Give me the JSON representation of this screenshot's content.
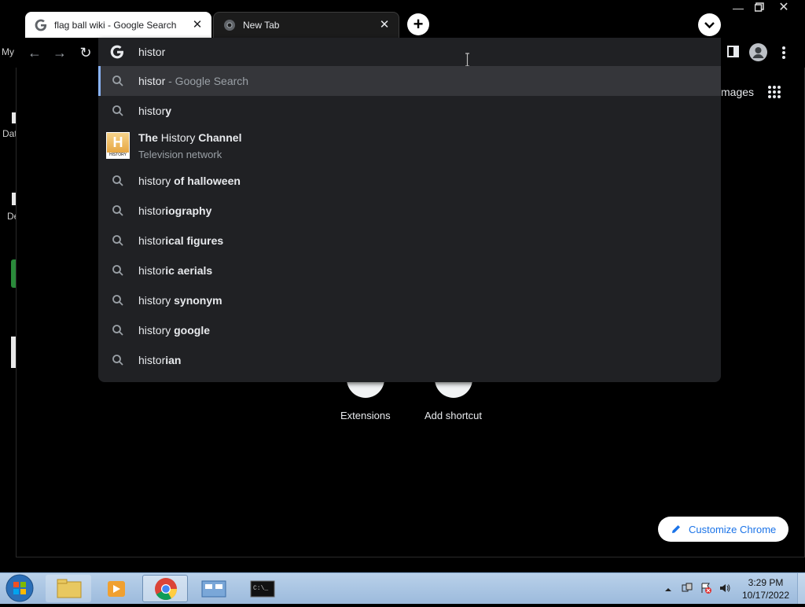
{
  "tabs": [
    {
      "title": "flag ball wiki - Google Search",
      "active": true,
      "favicon": "google-g-icon"
    },
    {
      "title": "New Tab",
      "active": false,
      "favicon": "chrome-icon"
    }
  ],
  "desktop_fragments": {
    "my": "My",
    "dat": "Dat",
    "de": "De"
  },
  "omnibox": {
    "value": "histor",
    "suggestions": [
      {
        "pre": "histor",
        "bold": "",
        "hint": " - Google Search",
        "selected": true
      },
      {
        "pre": "histor",
        "bold": "y",
        "hint": "",
        "selected": false
      },
      {
        "pre": "history",
        "bold": " of halloween",
        "hint": "",
        "selected": false
      },
      {
        "pre": "histor",
        "bold": "iography",
        "hint": "",
        "selected": false
      },
      {
        "pre": "histor",
        "bold": "ical figures",
        "hint": "",
        "selected": false
      },
      {
        "pre": "histor",
        "bold": "ic aerials",
        "hint": "",
        "selected": false
      },
      {
        "pre": "history",
        "bold": " synonym",
        "hint": "",
        "selected": false
      },
      {
        "pre": "history",
        "bold": " google",
        "hint": "",
        "selected": false
      },
      {
        "pre": "histor",
        "bold": "ian",
        "hint": "",
        "selected": false
      }
    ],
    "entity": {
      "title_bold1": "The",
      "title_plain": " History ",
      "title_bold2": "Channel",
      "subtitle": "Television network",
      "logo_text": "HISTORY"
    }
  },
  "ntp": {
    "images_label": "mages",
    "shortcuts": [
      {
        "label": "Extensions"
      },
      {
        "label": "Add shortcut"
      }
    ],
    "customize_label": "Customize Chrome"
  },
  "taskbar": {
    "time": "3:29 PM",
    "date": "10/17/2022"
  },
  "colors": {
    "accent_blue": "#8ab4f8",
    "link_blue": "#1a73e8",
    "dropdown_bg": "#202124",
    "selected_row": "#35363a"
  }
}
